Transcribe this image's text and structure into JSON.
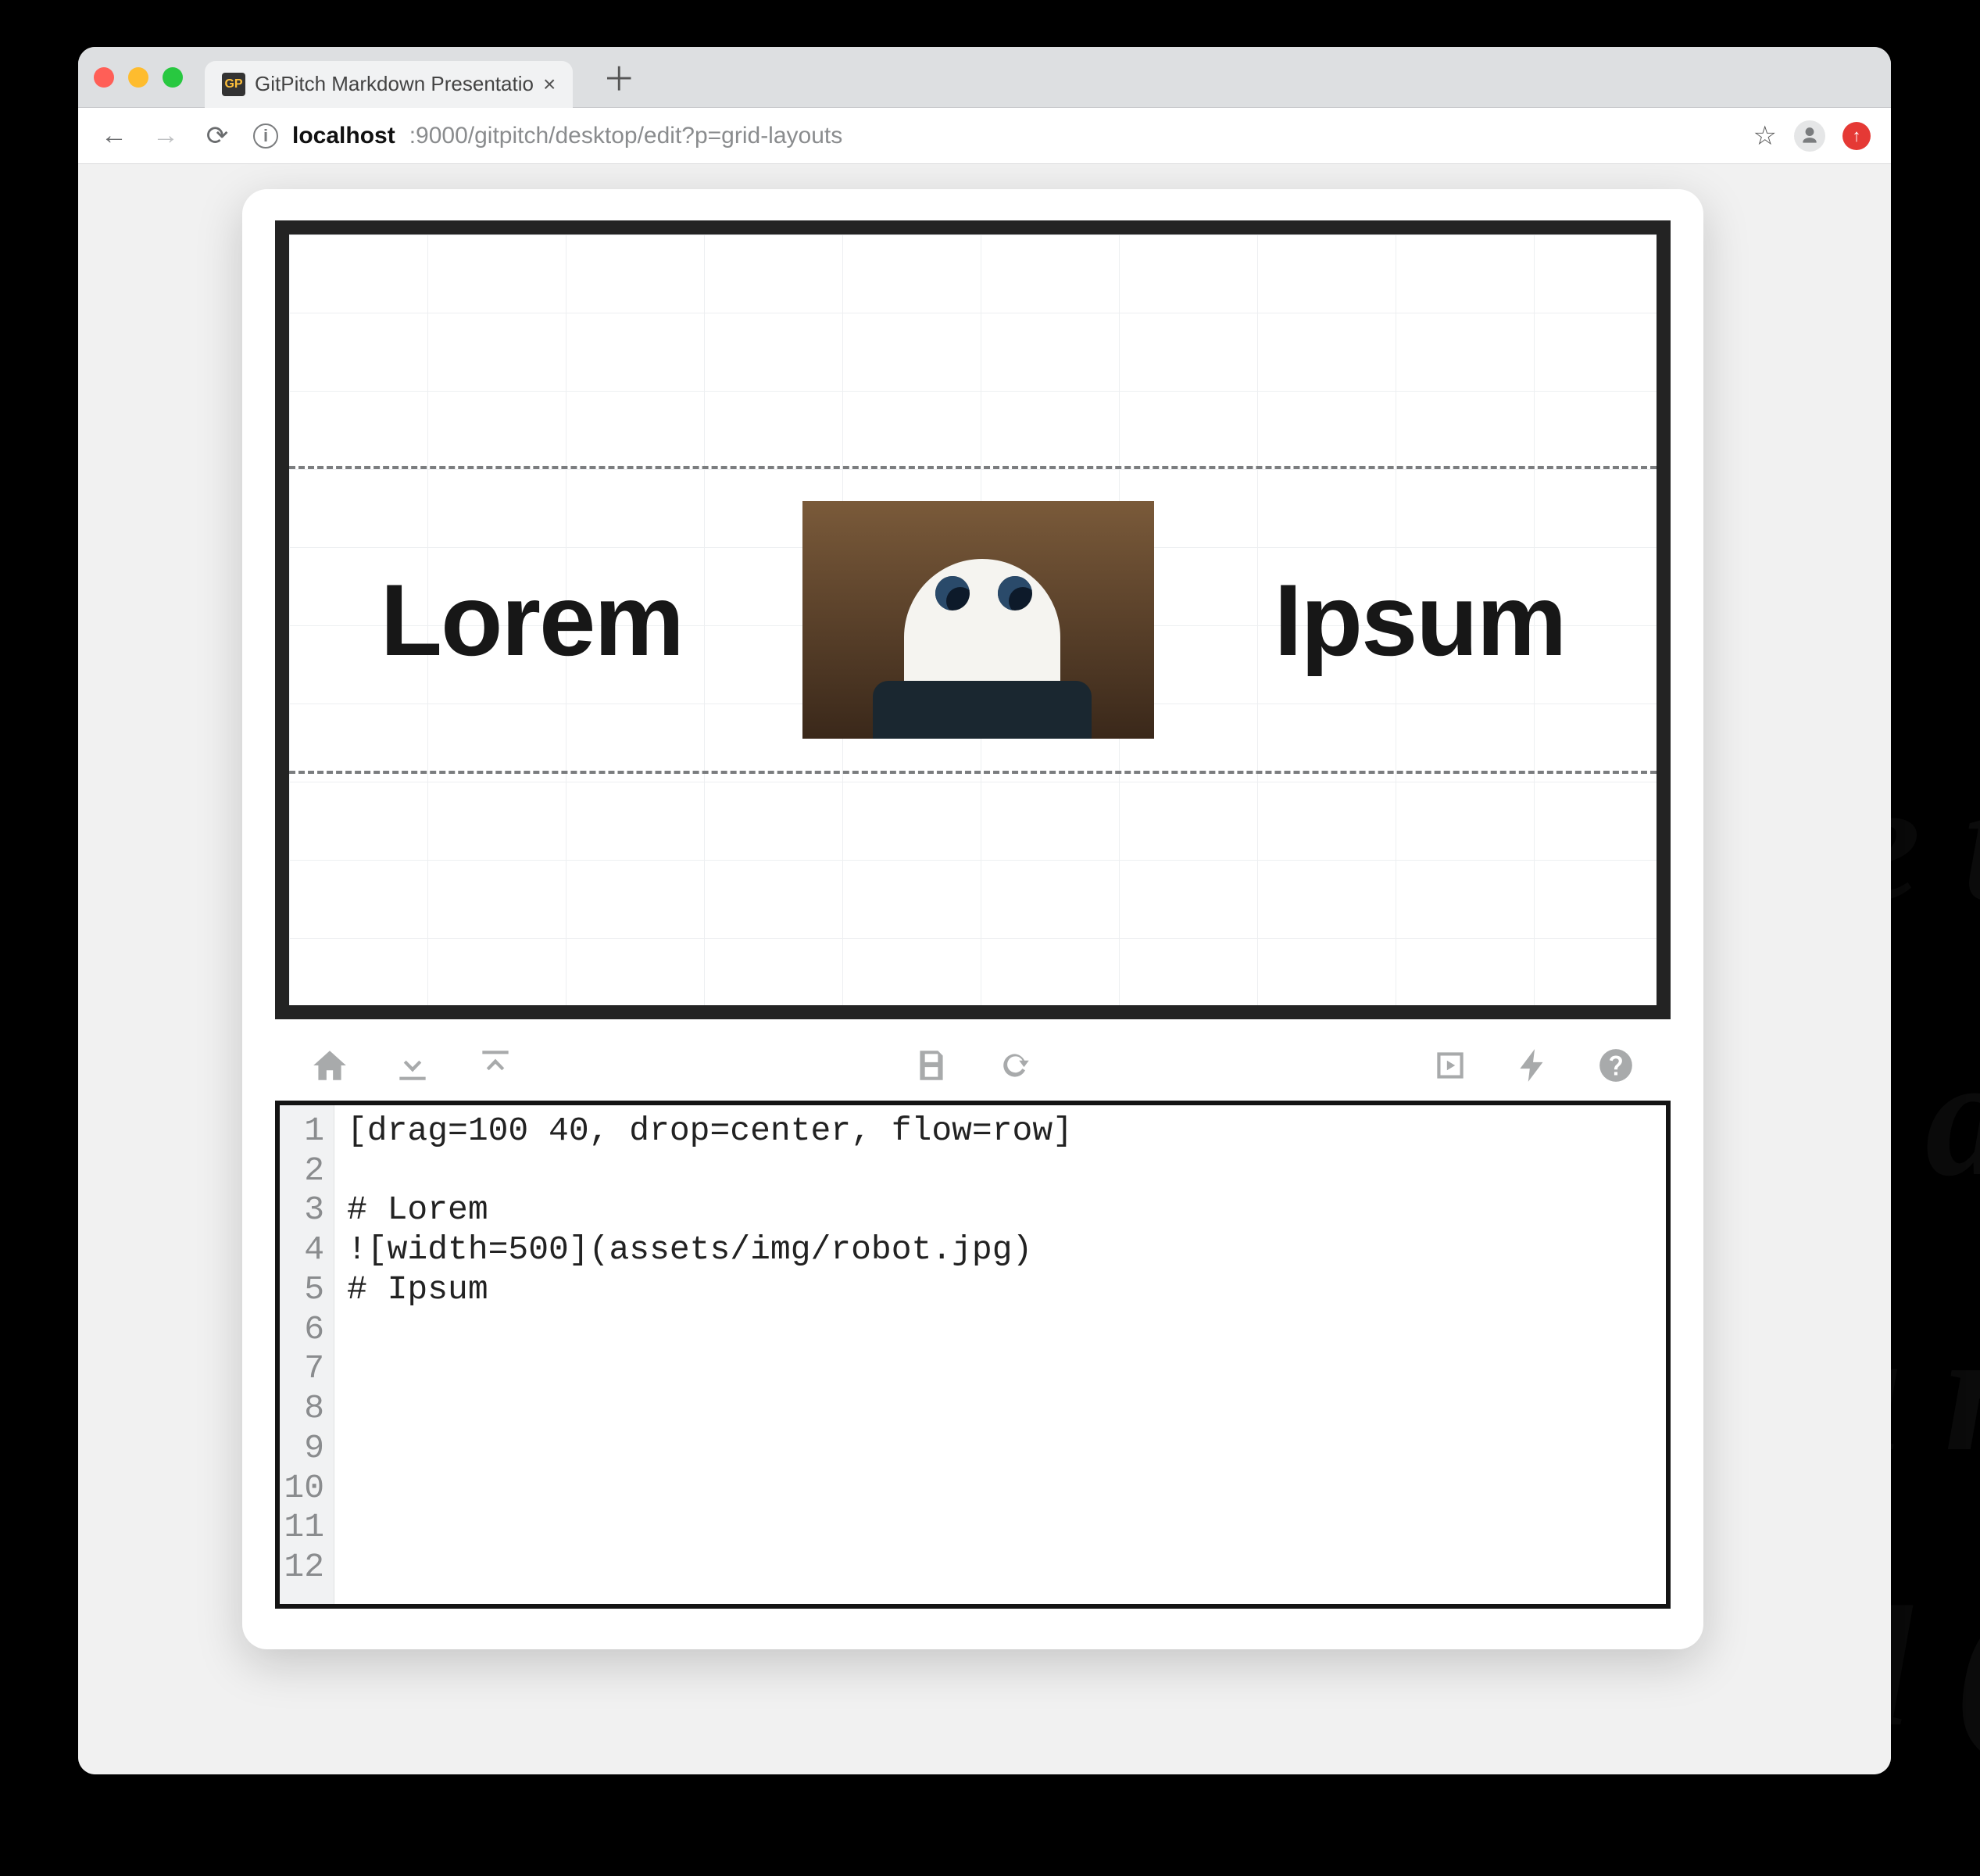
{
  "browser": {
    "tab_title": "GitPitch Markdown Presentatio",
    "tab_favicon_text": "GP",
    "new_tab_glyph": "＋",
    "url_host_full": "localhost",
    "url_port_path": ":9000/gitpitch/desktop/edit?p=grid-layouts",
    "star_glyph": "☆",
    "extension_badge": "↑"
  },
  "slide": {
    "left_heading": "Lorem",
    "right_heading": "Ipsum",
    "image_alt": "robot-photo"
  },
  "toolbar": {
    "home": "home-icon",
    "download": "download-icon",
    "upload": "upload-icon",
    "save": "save-icon",
    "refresh": "refresh-icon",
    "expand": "expand-icon",
    "bolt": "bolt-icon",
    "help": "help-icon"
  },
  "editor": {
    "line_count": 12,
    "lines": [
      "[drag=100 40, drop=center, flow=row]",
      "",
      "# Lorem",
      "![width=500](assets/img/robot.jpg)",
      "# Ipsum",
      "",
      "",
      "",
      "",
      "",
      "",
      ""
    ]
  },
  "bg_deco_lines": [
    "e t",
    "p a",
    "a r",
    "d ("
  ]
}
